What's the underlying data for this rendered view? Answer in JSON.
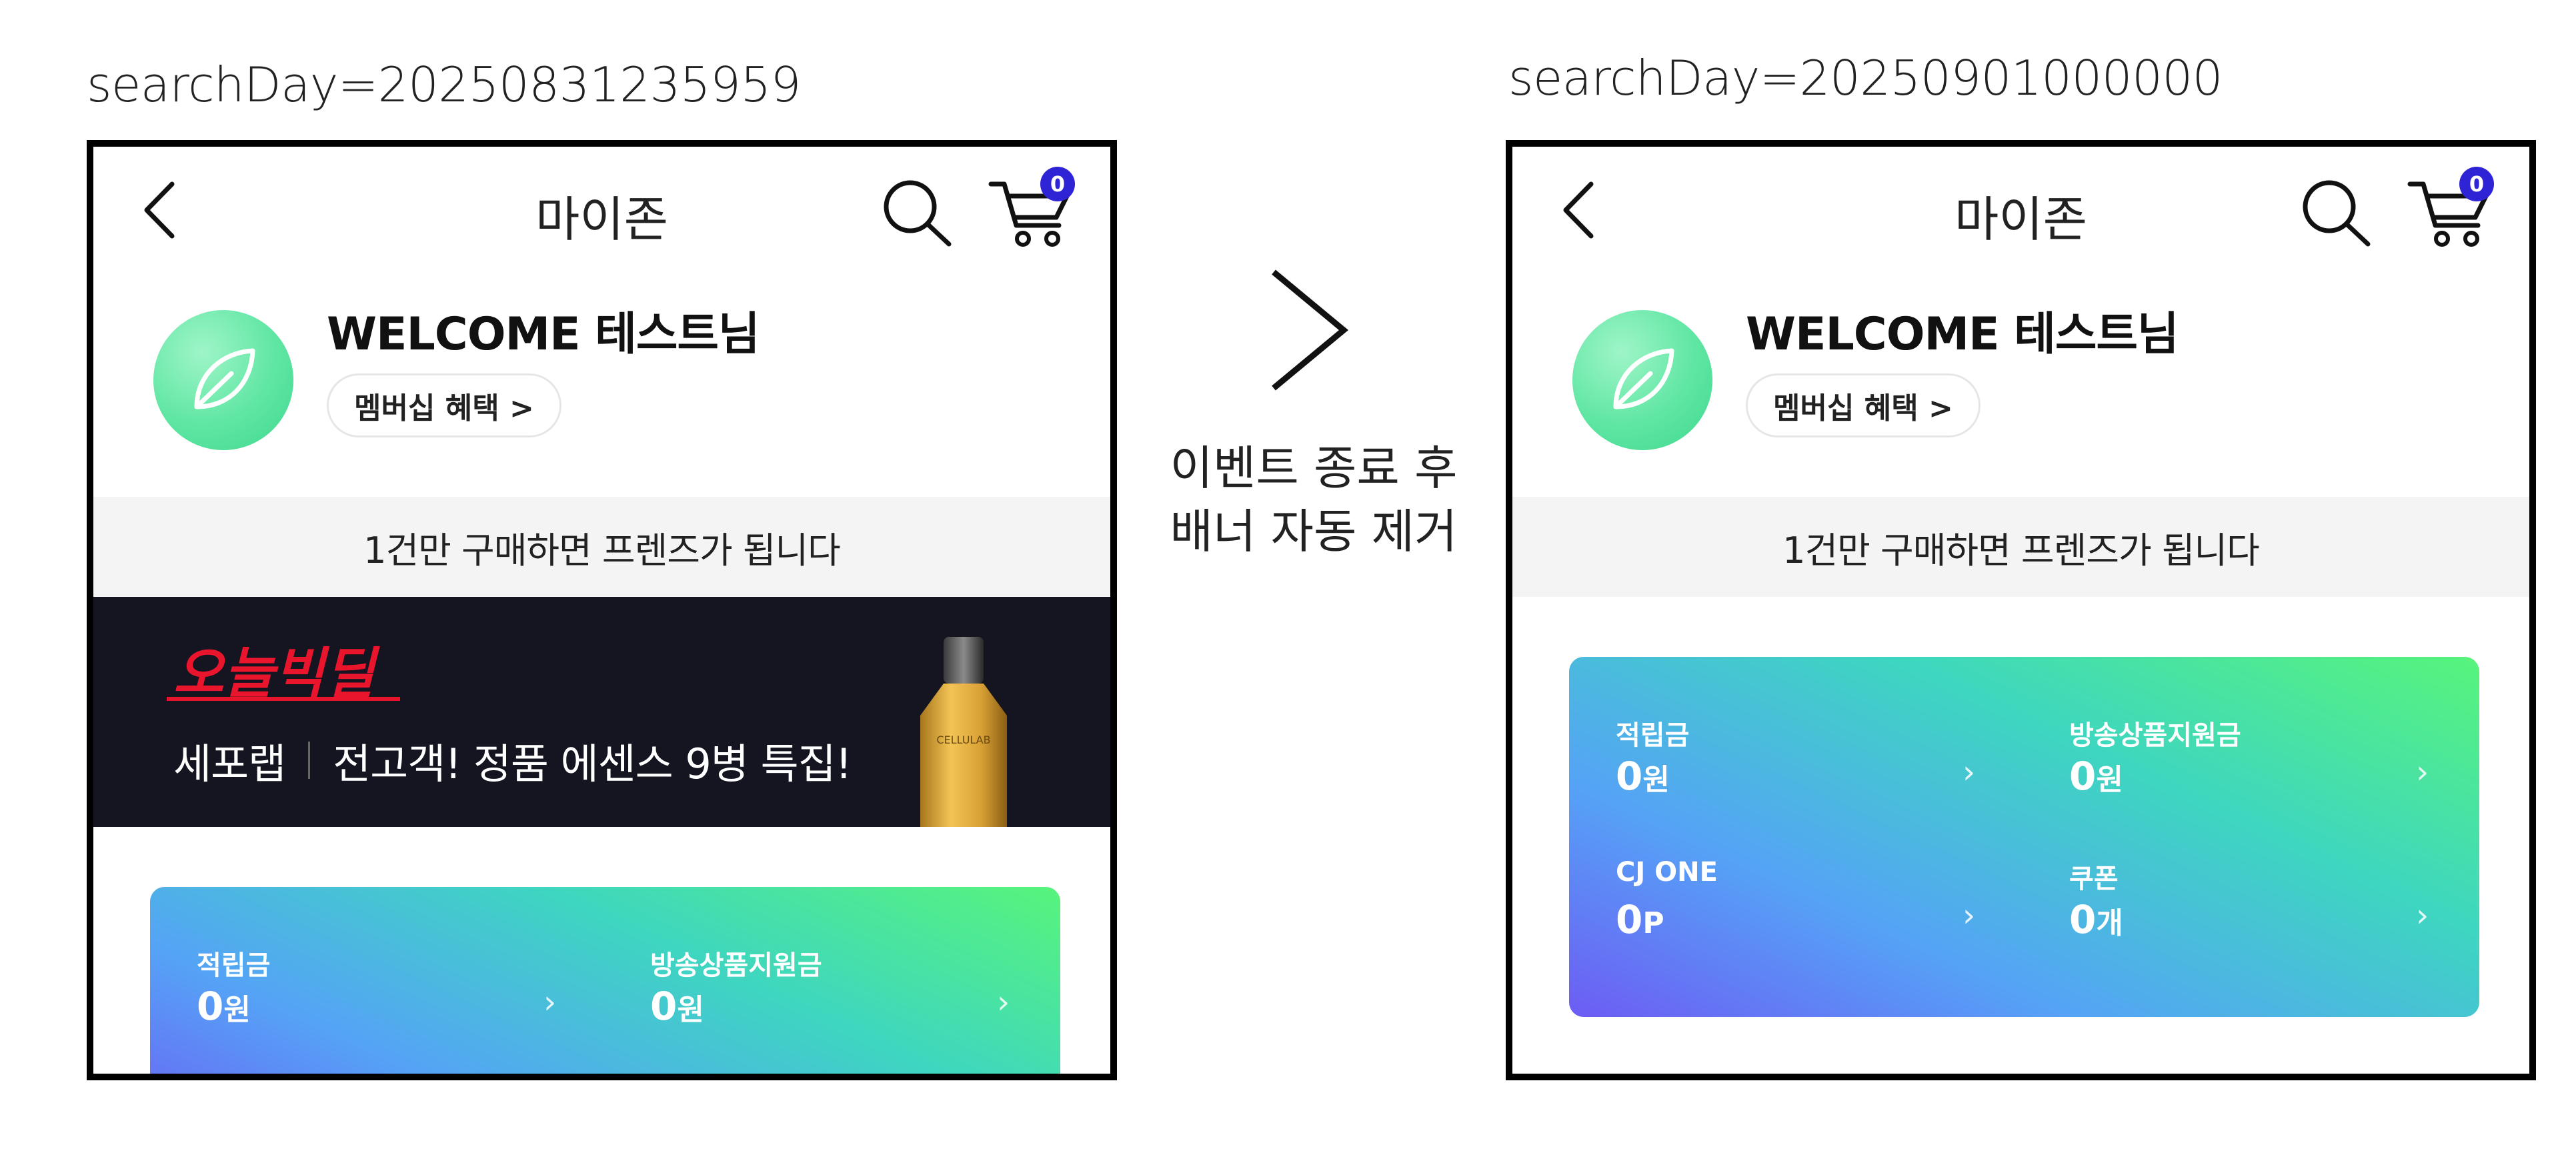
{
  "captions": {
    "before": "searchDay=20250831235959",
    "after": "searchDay=20250901000000"
  },
  "transition": {
    "line1": "이벤트 종료 후",
    "line2": "배너 자동 제거"
  },
  "app": {
    "title": "마이존",
    "cart_count": "0",
    "welcome": "WELCOME 테스트님",
    "membership_button": "멤버십 혜택 >",
    "friends_banner": "1건만 구매하면 프렌즈가 됩니다"
  },
  "promo": {
    "logo_text": "오늘빅딜",
    "brand": "세포랩",
    "headline": "전고객! 정품 에센스 9병 특집!",
    "bottle_label": "CELLULAB"
  },
  "points": [
    {
      "label": "적립금",
      "value": "0",
      "unit": "원"
    },
    {
      "label": "방송상품지원금",
      "value": "0",
      "unit": "원"
    },
    {
      "label": "CJ ONE",
      "value": "0",
      "unit": "P"
    },
    {
      "label": "쿠폰",
      "value": "0",
      "unit": "개"
    }
  ],
  "chevron": "›",
  "colors": {
    "badge": "#2f23d6",
    "avatar": "#5fe6a3",
    "banner_bg": "#141520",
    "promo_red": "#e8152d",
    "card_gradient_start": "#6d5cf4",
    "card_gradient_end": "#58f47b"
  },
  "icons": [
    "back-arrow-icon",
    "search-icon",
    "cart-icon",
    "leaf-icon",
    "chevron-right-icon",
    "bottle-image"
  ]
}
